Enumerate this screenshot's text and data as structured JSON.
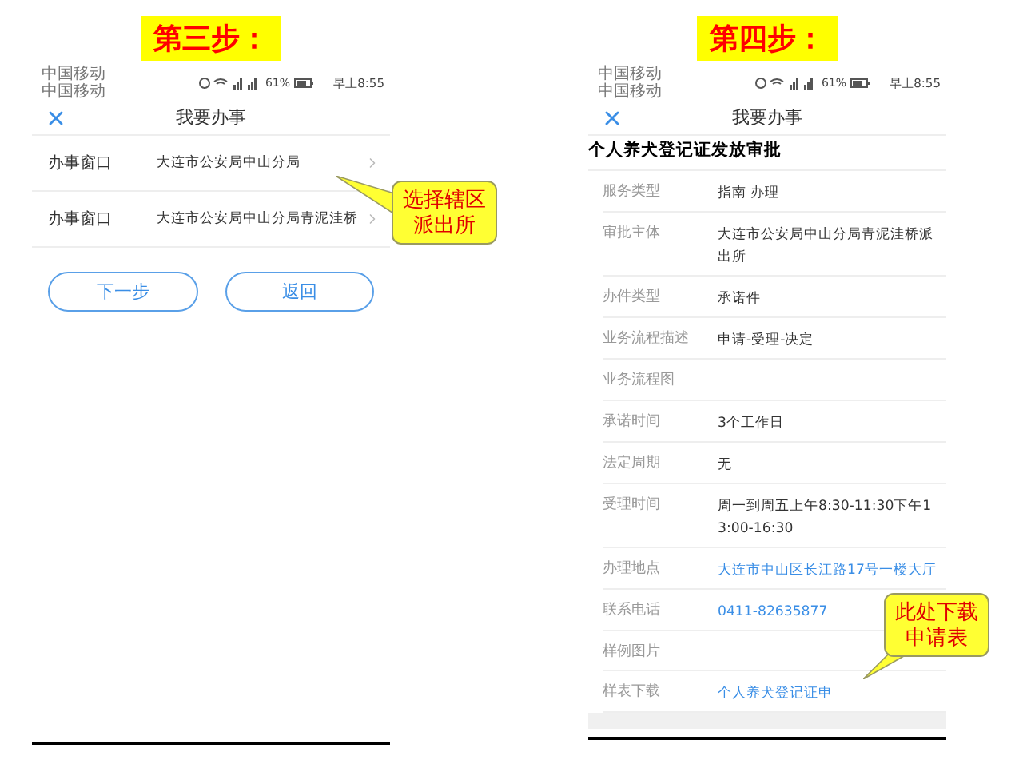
{
  "step3": {
    "label": "第三步：",
    "status_bar": {
      "carriers": [
        "中国移动",
        "中国移动"
      ],
      "battery": "61%",
      "time": "早上8:55"
    },
    "header": {
      "title": "我要办事"
    },
    "rows": [
      {
        "label": "办事窗口",
        "value": "大连市公安局中山分局"
      },
      {
        "label": "办事窗口",
        "value": "大连市公安局中山分局青泥洼桥"
      }
    ],
    "buttons": [
      "下一步",
      "返回"
    ],
    "callout": [
      "选择辖区",
      "派出所"
    ]
  },
  "step4": {
    "label": "第四步：",
    "status_bar": {
      "carriers": [
        "中国移动",
        "中国移动"
      ],
      "battery": "61%",
      "time": "早上8:55"
    },
    "header": {
      "title": "我要办事"
    },
    "heading": "个人养犬登记证发放审批",
    "fields": [
      {
        "label": "服务类型",
        "value": "指南 办理",
        "kind": "text"
      },
      {
        "label": "审批主体",
        "value": "大连市公安局中山分局青泥洼桥派出所",
        "kind": "text"
      },
      {
        "label": "办件类型",
        "value": "承诺件",
        "kind": "text"
      },
      {
        "label": "业务流程描述",
        "value": "申请-受理-决定",
        "kind": "text"
      },
      {
        "label": "业务流程图",
        "kind": "text"
      },
      {
        "label": "承诺时间",
        "value": "3个工作日",
        "kind": "text"
      },
      {
        "label": "法定周期",
        "value": "无",
        "kind": "text"
      },
      {
        "label": "受理时间",
        "value": "周一到周五上午8:30-11:30下午13:00-16:30",
        "kind": "text"
      },
      {
        "label": "办理地点",
        "value": "大连市中山区长江路17号一楼大厅",
        "kind": "link"
      },
      {
        "label": "联系电话",
        "value": "0411-82635877",
        "kind": "link"
      },
      {
        "label": "样例图片",
        "kind": "text"
      },
      {
        "label": "样表下载",
        "value": "个人养犬登记证申",
        "kind": "link"
      }
    ],
    "callout": [
      "此处下载",
      "申请表"
    ]
  }
}
